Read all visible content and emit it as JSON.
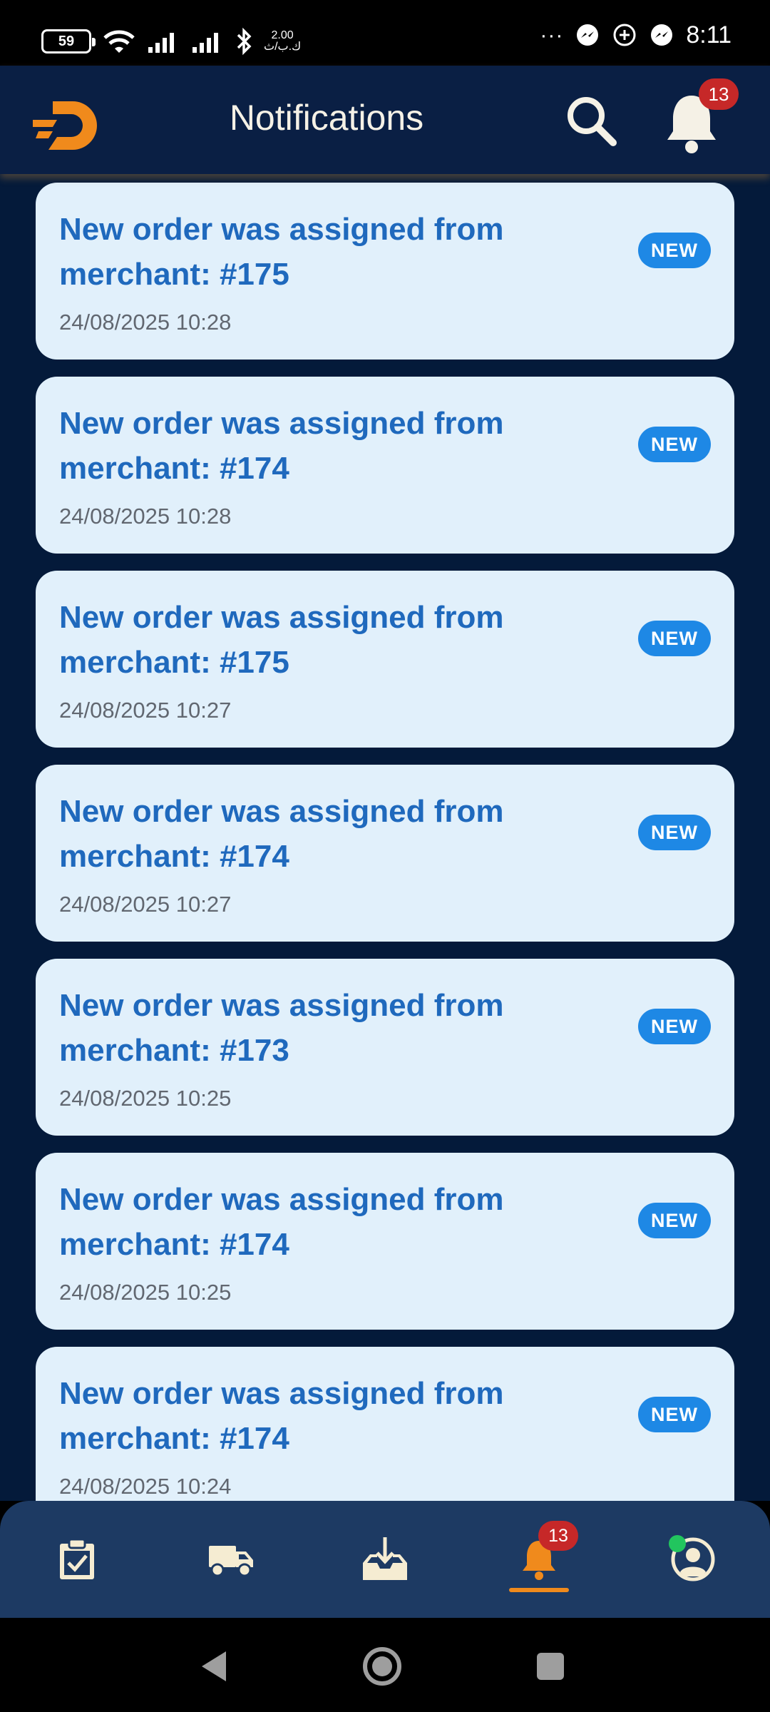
{
  "status_bar": {
    "battery": "59",
    "speed_value": "2.00",
    "speed_unit": "ك.ب/ث",
    "time": "8:11",
    "more": "···"
  },
  "header": {
    "title": "Notifications",
    "badge_count": "13"
  },
  "notifications": [
    {
      "title": "New order was assigned from merchant: #175",
      "time": "24/08/2025 10:28",
      "badge": "NEW"
    },
    {
      "title": "New order was assigned from merchant: #174",
      "time": "24/08/2025 10:28",
      "badge": "NEW"
    },
    {
      "title": "New order was assigned from merchant: #175",
      "time": "24/08/2025 10:27",
      "badge": "NEW"
    },
    {
      "title": "New order was assigned from merchant: #174",
      "time": "24/08/2025 10:27",
      "badge": "NEW"
    },
    {
      "title": "New order was assigned from merchant: #173",
      "time": "24/08/2025 10:25",
      "badge": "NEW"
    },
    {
      "title": "New order was assigned from merchant: #174",
      "time": "24/08/2025 10:25",
      "badge": "NEW"
    },
    {
      "title": "New order was assigned from merchant: #174",
      "time": "24/08/2025 10:24",
      "badge": "NEW"
    }
  ],
  "bottom_nav": {
    "items": [
      {
        "icon": "clipboard-check-icon"
      },
      {
        "icon": "truck-icon"
      },
      {
        "icon": "inbox-download-icon"
      },
      {
        "icon": "bell-icon",
        "active": true
      },
      {
        "icon": "profile-icon"
      }
    ],
    "badge_count": "13"
  },
  "colors": {
    "header_bg": "#0a1f44",
    "content_bg": "#041a3a",
    "card_bg": "#e1f0fb",
    "title_text": "#1f69bd",
    "new_badge": "#1e88e5",
    "accent": "#f08a1c",
    "count_badge": "#c62828"
  }
}
